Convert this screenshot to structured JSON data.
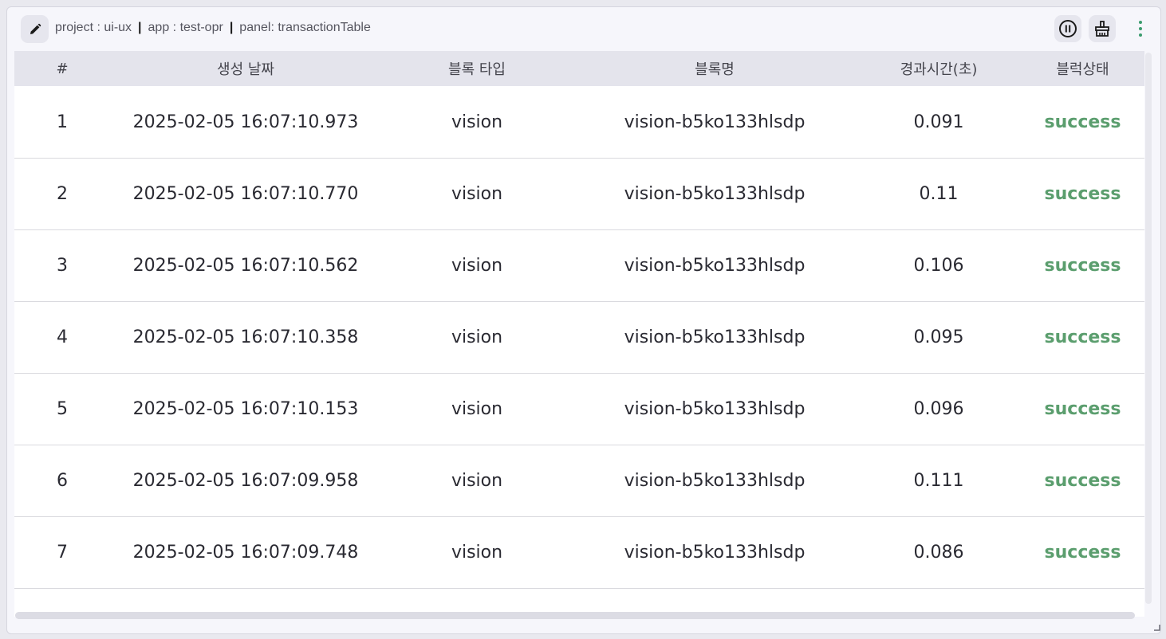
{
  "header": {
    "project": "project : ui-ux",
    "app": "app : test-opr",
    "panel": "panel: transactionTable",
    "separator": "|"
  },
  "icons": {
    "edit": "pencil-icon",
    "pause": "pause-icon",
    "clear": "broom-icon",
    "more": "more-vertical-icon"
  },
  "colors": {
    "status_success": "#5b9e6e",
    "header_bg": "#e4e4ec",
    "accent": "#3b9c6e"
  },
  "table": {
    "columns": [
      "#",
      "생성 날짜",
      "블록 타입",
      "블록명",
      "경과시간(초)",
      "블럭상태"
    ],
    "rows": [
      [
        "1",
        "2025-02-05 16:07:10.973",
        "vision",
        "vision-b5ko133hlsdp",
        "0.091",
        "success"
      ],
      [
        "2",
        "2025-02-05 16:07:10.770",
        "vision",
        "vision-b5ko133hlsdp",
        "0.11",
        "success"
      ],
      [
        "3",
        "2025-02-05 16:07:10.562",
        "vision",
        "vision-b5ko133hlsdp",
        "0.106",
        "success"
      ],
      [
        "4",
        "2025-02-05 16:07:10.358",
        "vision",
        "vision-b5ko133hlsdp",
        "0.095",
        "success"
      ],
      [
        "5",
        "2025-02-05 16:07:10.153",
        "vision",
        "vision-b5ko133hlsdp",
        "0.096",
        "success"
      ],
      [
        "6",
        "2025-02-05 16:07:09.958",
        "vision",
        "vision-b5ko133hlsdp",
        "0.111",
        "success"
      ],
      [
        "7",
        "2025-02-05 16:07:09.748",
        "vision",
        "vision-b5ko133hlsdp",
        "0.086",
        "success"
      ]
    ]
  }
}
